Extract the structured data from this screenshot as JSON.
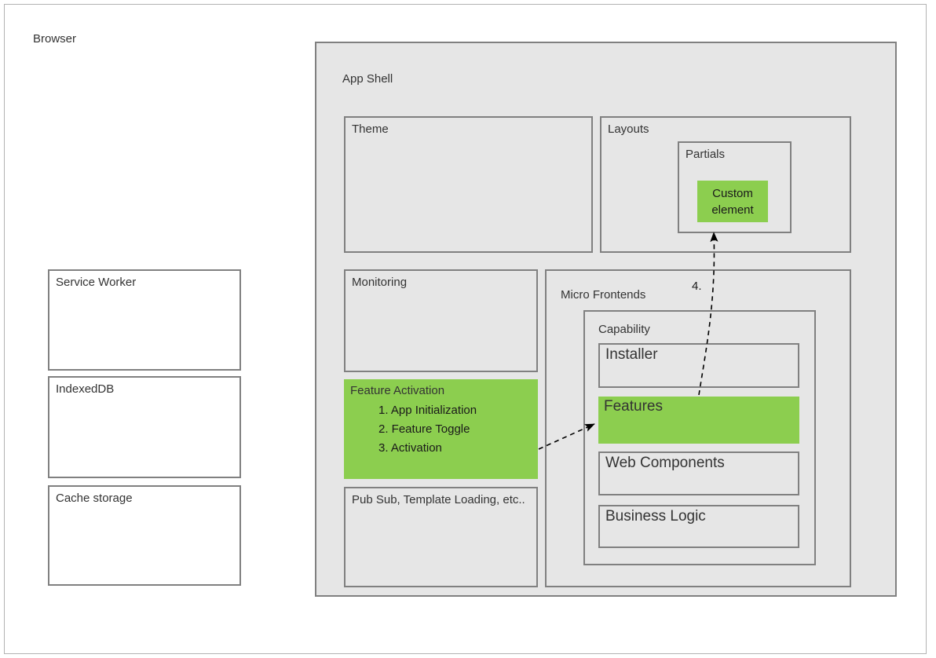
{
  "diagram": {
    "title": "Browser",
    "outer": {
      "label": "Browser"
    },
    "browser_resources": [
      {
        "label": "Service Worker",
        "name": "service-worker"
      },
      {
        "label": "IndexedDB",
        "name": "indexeddb"
      },
      {
        "label": "Cache storage",
        "name": "cache-storage"
      }
    ],
    "app_shell": {
      "label": "App Shell",
      "theme": {
        "label": "Theme"
      },
      "layouts": {
        "label": "Layouts",
        "partials": {
          "label": "Partials",
          "custom_element": {
            "label": "Custom element",
            "color": "#8CCE4F"
          }
        }
      },
      "monitoring": {
        "label": "Monitoring"
      },
      "feature_activation": {
        "label": "Feature Activation",
        "color": "#8CCE4F",
        "steps": [
          "1. App Initialization",
          "2. Feature Toggle",
          "3. Activation"
        ]
      },
      "pub_sub": {
        "label": "Pub Sub, Template Loading, etc.."
      },
      "micro_frontends": {
        "label": "Micro Frontends",
        "capability": {
          "label": "Capability",
          "items": [
            {
              "label": "Installer",
              "highlight": false
            },
            {
              "label": "Features",
              "highlight": true
            },
            {
              "label": "Web Components",
              "highlight": false
            },
            {
              "label": "Business Logic",
              "highlight": false
            }
          ]
        }
      }
    },
    "connectors": [
      {
        "name": "activation-to-features",
        "label": "",
        "style": "dashed-arrow"
      },
      {
        "name": "features-to-custom-element",
        "label": "4.",
        "style": "dashed-arrow"
      }
    ],
    "colors": {
      "highlight_green": "#8CCE4F",
      "panel_grey": "#e6e6e6",
      "border_grey": "#808080",
      "frame_grey": "#b3b3b3"
    }
  }
}
